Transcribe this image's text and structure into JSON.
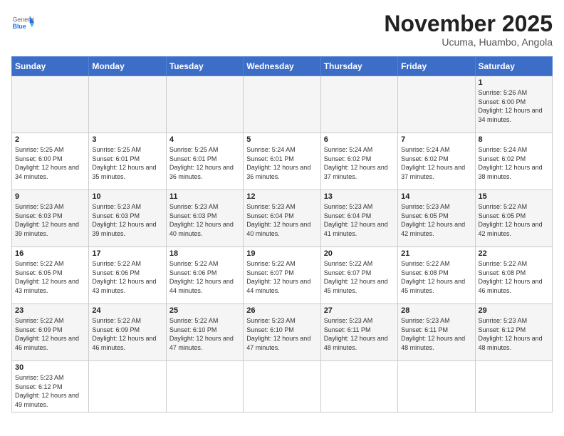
{
  "header": {
    "logo_general": "General",
    "logo_blue": "Blue",
    "month_title": "November 2025",
    "subtitle": "Ucuma, Huambo, Angola"
  },
  "days_of_week": [
    "Sunday",
    "Monday",
    "Tuesday",
    "Wednesday",
    "Thursday",
    "Friday",
    "Saturday"
  ],
  "weeks": [
    [
      {
        "day": "",
        "info": ""
      },
      {
        "day": "",
        "info": ""
      },
      {
        "day": "",
        "info": ""
      },
      {
        "day": "",
        "info": ""
      },
      {
        "day": "",
        "info": ""
      },
      {
        "day": "",
        "info": ""
      },
      {
        "day": "1",
        "info": "Sunrise: 5:26 AM\nSunset: 6:00 PM\nDaylight: 12 hours and 34 minutes."
      }
    ],
    [
      {
        "day": "2",
        "info": "Sunrise: 5:25 AM\nSunset: 6:00 PM\nDaylight: 12 hours and 34 minutes."
      },
      {
        "day": "3",
        "info": "Sunrise: 5:25 AM\nSunset: 6:01 PM\nDaylight: 12 hours and 35 minutes."
      },
      {
        "day": "4",
        "info": "Sunrise: 5:25 AM\nSunset: 6:01 PM\nDaylight: 12 hours and 36 minutes."
      },
      {
        "day": "5",
        "info": "Sunrise: 5:24 AM\nSunset: 6:01 PM\nDaylight: 12 hours and 36 minutes."
      },
      {
        "day": "6",
        "info": "Sunrise: 5:24 AM\nSunset: 6:02 PM\nDaylight: 12 hours and 37 minutes."
      },
      {
        "day": "7",
        "info": "Sunrise: 5:24 AM\nSunset: 6:02 PM\nDaylight: 12 hours and 37 minutes."
      },
      {
        "day": "8",
        "info": "Sunrise: 5:24 AM\nSunset: 6:02 PM\nDaylight: 12 hours and 38 minutes."
      }
    ],
    [
      {
        "day": "9",
        "info": "Sunrise: 5:23 AM\nSunset: 6:03 PM\nDaylight: 12 hours and 39 minutes."
      },
      {
        "day": "10",
        "info": "Sunrise: 5:23 AM\nSunset: 6:03 PM\nDaylight: 12 hours and 39 minutes."
      },
      {
        "day": "11",
        "info": "Sunrise: 5:23 AM\nSunset: 6:03 PM\nDaylight: 12 hours and 40 minutes."
      },
      {
        "day": "12",
        "info": "Sunrise: 5:23 AM\nSunset: 6:04 PM\nDaylight: 12 hours and 40 minutes."
      },
      {
        "day": "13",
        "info": "Sunrise: 5:23 AM\nSunset: 6:04 PM\nDaylight: 12 hours and 41 minutes."
      },
      {
        "day": "14",
        "info": "Sunrise: 5:23 AM\nSunset: 6:05 PM\nDaylight: 12 hours and 42 minutes."
      },
      {
        "day": "15",
        "info": "Sunrise: 5:22 AM\nSunset: 6:05 PM\nDaylight: 12 hours and 42 minutes."
      }
    ],
    [
      {
        "day": "16",
        "info": "Sunrise: 5:22 AM\nSunset: 6:05 PM\nDaylight: 12 hours and 43 minutes."
      },
      {
        "day": "17",
        "info": "Sunrise: 5:22 AM\nSunset: 6:06 PM\nDaylight: 12 hours and 43 minutes."
      },
      {
        "day": "18",
        "info": "Sunrise: 5:22 AM\nSunset: 6:06 PM\nDaylight: 12 hours and 44 minutes."
      },
      {
        "day": "19",
        "info": "Sunrise: 5:22 AM\nSunset: 6:07 PM\nDaylight: 12 hours and 44 minutes."
      },
      {
        "day": "20",
        "info": "Sunrise: 5:22 AM\nSunset: 6:07 PM\nDaylight: 12 hours and 45 minutes."
      },
      {
        "day": "21",
        "info": "Sunrise: 5:22 AM\nSunset: 6:08 PM\nDaylight: 12 hours and 45 minutes."
      },
      {
        "day": "22",
        "info": "Sunrise: 5:22 AM\nSunset: 6:08 PM\nDaylight: 12 hours and 46 minutes."
      }
    ],
    [
      {
        "day": "23",
        "info": "Sunrise: 5:22 AM\nSunset: 6:09 PM\nDaylight: 12 hours and 46 minutes."
      },
      {
        "day": "24",
        "info": "Sunrise: 5:22 AM\nSunset: 6:09 PM\nDaylight: 12 hours and 46 minutes."
      },
      {
        "day": "25",
        "info": "Sunrise: 5:22 AM\nSunset: 6:10 PM\nDaylight: 12 hours and 47 minutes."
      },
      {
        "day": "26",
        "info": "Sunrise: 5:23 AM\nSunset: 6:10 PM\nDaylight: 12 hours and 47 minutes."
      },
      {
        "day": "27",
        "info": "Sunrise: 5:23 AM\nSunset: 6:11 PM\nDaylight: 12 hours and 48 minutes."
      },
      {
        "day": "28",
        "info": "Sunrise: 5:23 AM\nSunset: 6:11 PM\nDaylight: 12 hours and 48 minutes."
      },
      {
        "day": "29",
        "info": "Sunrise: 5:23 AM\nSunset: 6:12 PM\nDaylight: 12 hours and 48 minutes."
      }
    ],
    [
      {
        "day": "30",
        "info": "Sunrise: 5:23 AM\nSunset: 6:12 PM\nDaylight: 12 hours and 49 minutes."
      },
      {
        "day": "",
        "info": ""
      },
      {
        "day": "",
        "info": ""
      },
      {
        "day": "",
        "info": ""
      },
      {
        "day": "",
        "info": ""
      },
      {
        "day": "",
        "info": ""
      },
      {
        "day": "",
        "info": ""
      }
    ]
  ]
}
